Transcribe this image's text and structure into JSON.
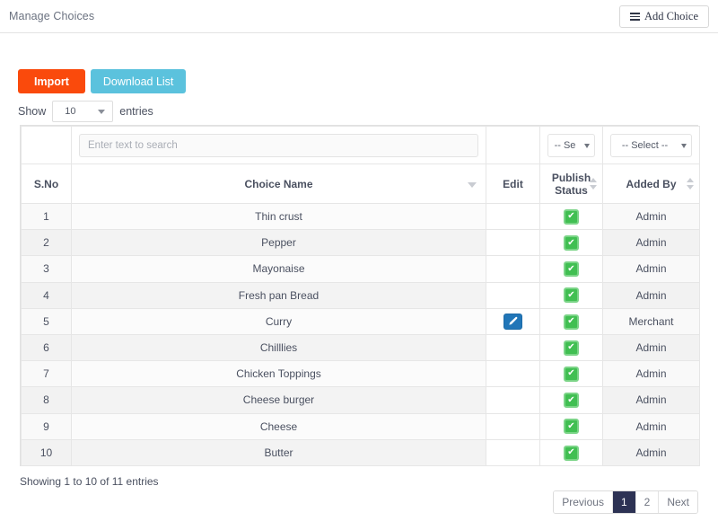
{
  "header": {
    "title": "Manage Choices",
    "add_button_label": "Add Choice",
    "add_button_icon": "hamburger-icon"
  },
  "toolbar": {
    "import_label": "Import",
    "download_label": "Download List"
  },
  "length_menu": {
    "prefix": "Show",
    "value": "10",
    "suffix": "entries"
  },
  "filters": {
    "search_placeholder": "Enter text to search",
    "search_value": "",
    "publish_status_select": "-- Se",
    "added_by_select": "-- Select --"
  },
  "table": {
    "columns": [
      {
        "label": "S.No",
        "sort": "none"
      },
      {
        "label": "Choice Name",
        "sort": "desc"
      },
      {
        "label": "Edit",
        "sort": "none"
      },
      {
        "label": "Publish Status",
        "sort": "both"
      },
      {
        "label": "Added By",
        "sort": "both"
      }
    ],
    "column_labels": {
      "sno": "S.No",
      "choice_name": "Choice Name",
      "edit": "Edit",
      "publish_status_line1": "Publish",
      "publish_status_line2": "Status",
      "added_by": "Added By"
    },
    "rows": [
      {
        "sno": "1",
        "choice_name": "Thin crust",
        "has_edit": false,
        "published": true,
        "added_by": "Admin"
      },
      {
        "sno": "2",
        "choice_name": "Pepper",
        "has_edit": false,
        "published": true,
        "added_by": "Admin"
      },
      {
        "sno": "3",
        "choice_name": "Mayonaise",
        "has_edit": false,
        "published": true,
        "added_by": "Admin"
      },
      {
        "sno": "4",
        "choice_name": "Fresh pan Bread",
        "has_edit": false,
        "published": true,
        "added_by": "Admin"
      },
      {
        "sno": "5",
        "choice_name": "Curry",
        "has_edit": true,
        "published": true,
        "added_by": "Merchant"
      },
      {
        "sno": "6",
        "choice_name": "Chilllies",
        "has_edit": false,
        "published": true,
        "added_by": "Admin"
      },
      {
        "sno": "7",
        "choice_name": "Chicken Toppings",
        "has_edit": false,
        "published": true,
        "added_by": "Admin"
      },
      {
        "sno": "8",
        "choice_name": "Cheese burger",
        "has_edit": false,
        "published": true,
        "added_by": "Admin"
      },
      {
        "sno": "9",
        "choice_name": "Cheese",
        "has_edit": false,
        "published": true,
        "added_by": "Admin"
      },
      {
        "sno": "10",
        "choice_name": "Butter",
        "has_edit": false,
        "published": true,
        "added_by": "Admin"
      }
    ]
  },
  "footer": {
    "showing_text": "Showing 1 to 10 of 11 entries",
    "pagination": [
      {
        "label": "Previous",
        "active": false
      },
      {
        "label": "1",
        "active": true
      },
      {
        "label": "2",
        "active": false
      },
      {
        "label": "Next",
        "active": false
      }
    ]
  },
  "colors": {
    "import_button": "#fa4a0c",
    "download_button": "#5bc2dd",
    "checkbox_green": "#41bf52",
    "edit_button_blue": "#2176b8",
    "pagination_active": "#2d3254"
  }
}
